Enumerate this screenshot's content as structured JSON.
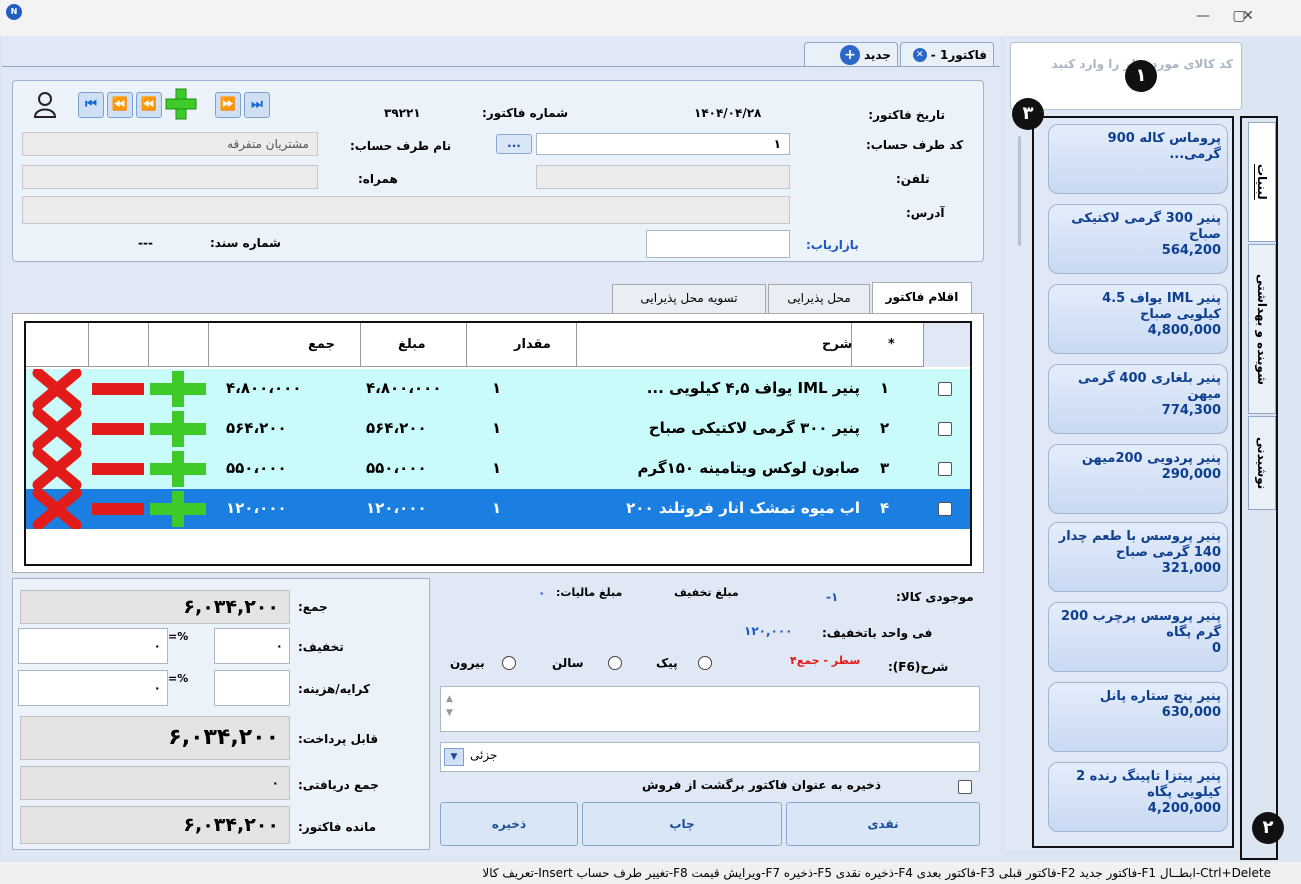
{
  "window": {
    "logo": "N",
    "minimize": "—",
    "maximize": "▢",
    "close": "✕"
  },
  "tabs": {
    "invoice_tab": "فاکتور1 -",
    "new_tab": "جدید",
    "close_glyph": "✕",
    "plus_glyph": "+"
  },
  "header": {
    "invoice_date_label": "تاریخ فاکتور:",
    "invoice_date": "۱۴۰۴/۰۴/۲۸",
    "invoice_no_label": "شماره فاکتور:",
    "invoice_no": "۳۹۲۲۱",
    "account_code_label": "کد طرف حساب:",
    "account_code": "۱",
    "browse_button": "...",
    "account_name_label": "نام طرف حساب:",
    "account_name": "مشتریان متفرقه",
    "phone_label": "تلفن:",
    "mobile_label": "همراه:",
    "address_label": "آدرس:",
    "marketer_label": "بازاریاب:",
    "doc_no_label": "شماره سند:",
    "doc_no": "---"
  },
  "nav": {
    "first": "⏮",
    "prev": "⏪",
    "add": "+",
    "next": "⏩",
    "last": "⏭",
    "user_icon": "8"
  },
  "inner_tabs": [
    "اقلام فاکتور",
    "محل پذیرایی",
    "تسویه محل پذیرایی"
  ],
  "grid": {
    "headers": {
      "star": "*",
      "desc": "شرح",
      "qty": "مقدار",
      "price": "مبلغ",
      "total": "جمع"
    },
    "rows": [
      {
        "n": "۱",
        "desc": "پنیر IML یواف ۴,۵ کیلویی ...",
        "qty": "۱",
        "price": "۴،۸۰۰،۰۰۰",
        "total": "۴،۸۰۰،۰۰۰"
      },
      {
        "n": "۲",
        "desc": "پنیر ۳۰۰ گرمی لاکتیکی صباح",
        "qty": "۱",
        "price": "۵۶۴،۲۰۰",
        "total": "۵۶۴،۲۰۰"
      },
      {
        "n": "۳",
        "desc": "صابون لوکس ویتامینه ۱۵۰گرم",
        "qty": "۱",
        "price": "۵۵۰،۰۰۰",
        "total": "۵۵۰،۰۰۰"
      },
      {
        "n": "۴",
        "desc": "اب میوه تمشک انار فروتلند ۲۰۰",
        "qty": "۱",
        "price": "۱۲۰،۰۰۰",
        "total": "۱۲۰،۰۰۰"
      }
    ]
  },
  "details": {
    "stock_label": "موجودی کالا:",
    "stock": "-۱",
    "discount_amount_label": "مبلغ تخفیف",
    "tax_label": "مبلغ مالیات:",
    "tax": "۰",
    "unit_price_label": "فی واحد باتخفیف:",
    "unit_price": "۱۲۰,۰۰۰",
    "desc_label": "شرح(F6):",
    "desc_value": "۴سطر - جمع",
    "radio_options": [
      "پیک",
      "سالن",
      "بیرون"
    ],
    "price_level": "جزئی",
    "return_checkbox": "ذخیره به عنوان فاکتور برگشت از فروش",
    "cash_button": "نقدی",
    "print_button": "چاپ",
    "save_button": "ذخیره"
  },
  "summary": {
    "sum_label": "جمع:",
    "sum": "۶,۰۳۴,۲۰۰",
    "discount_label": "تخفیف:",
    "discount_value": "۰",
    "discount_pct": "۰",
    "pct_sign": "=%",
    "fee_label": "کرایه/هزینه:",
    "fee_pct": "۰",
    "payable_label": "قابل پرداخت:",
    "payable": "۶,۰۳۴,۲۰۰",
    "received_label": "جمع دریافتی:",
    "received": "۰",
    "remaining_label": "مانده فاکتور:",
    "remaining": "۶,۰۳۴,۲۰۰"
  },
  "sidebar": {
    "search_placeholder": "کد کالای مورد نظر را وارد کنید",
    "products": [
      {
        "name": "پروماس کاله 900 گرمی...",
        "price": ""
      },
      {
        "name": "پنیر 300 گرمی لاکتیکی صباح",
        "price": "564,200"
      },
      {
        "name": "پنیر IML یواف 4.5 کیلویی صباح",
        "price": "4,800,000"
      },
      {
        "name": "پنیر بلغاری 400 گرمی میهن",
        "price": "774,300"
      },
      {
        "name": "پنیر پردویی 200میهن",
        "price": "290,000"
      },
      {
        "name": "پنیر پروسس با طعم چدار 140 گرمی صباح",
        "price": "321,000"
      },
      {
        "name": "پنیر پروسس پرچرب 200 گرم پگاه",
        "price": "0"
      },
      {
        "name": "پنیر پنج ستاره پانل",
        "price": "630,000"
      },
      {
        "name": "پنیر پیتزا تاپینگ رنده 2 کیلویی پگاه",
        "price": "4,200,000"
      }
    ],
    "categories": [
      "لبنیات",
      "شوینده و بهداشتی",
      "نوشیدنی"
    ]
  },
  "badges": {
    "b1": "۱",
    "b2": "۲",
    "b3": "۳"
  },
  "statusbar": "Ctrl+Delete-ابطــال  F1-فاکتور جدید  F2-فاکتور قبلی  F3-فاکتور بعدی  F4-ذخیره نقدی  F5-ذخیره  F7-ویرایش قیمت  F8-تغییر طرف حساب  Insert-تعریف کالا",
  "colors": {
    "row_alt": "#c9fbfb",
    "row_selected": "#1a7fe0",
    "accent": "#2b67c8",
    "red": "#e21b1b",
    "green": "#3ecb2a"
  }
}
